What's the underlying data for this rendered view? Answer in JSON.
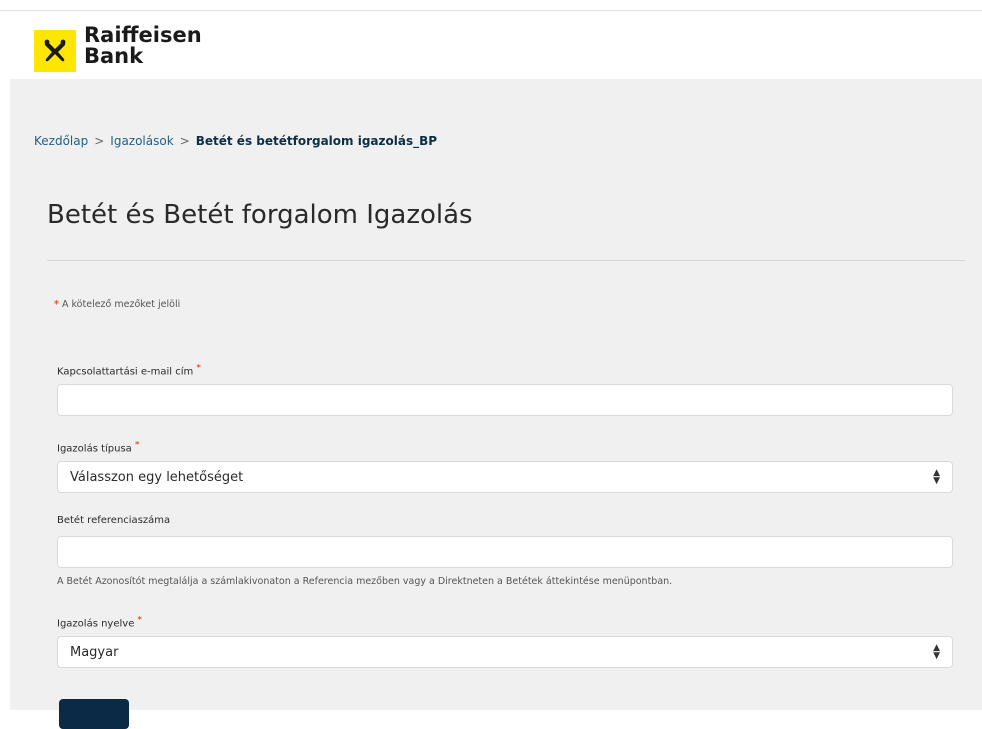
{
  "brand": {
    "logo_line1": "Raiffeisen",
    "logo_line2": "Bank",
    "logo_color": "#fee600"
  },
  "breadcrumb": {
    "items": [
      "Kezdőlap",
      "Igazolások"
    ],
    "current": "Betét és betétforgalom igazolás_BP",
    "separator": ">"
  },
  "page": {
    "title": "Betét és Betét forgalom Igazolás",
    "required_note": "A kötelező mezőket jelöli",
    "required_mark": "*"
  },
  "form": {
    "email": {
      "label": "Kapcsolattartási e-mail cím",
      "value": ""
    },
    "type": {
      "label": "Igazolás típusa",
      "selected": "Válasszon egy lehetőséget"
    },
    "reference": {
      "label": "Betét referenciaszáma",
      "value": "",
      "help": "A Betét Azonosítót megtalálja a számlakivonaton a Referencia mezőben vagy a Direktneten a Betétek áttekintése menüpontban."
    },
    "language": {
      "label": "Igazolás nyelve",
      "selected": "Magyar"
    }
  },
  "colors": {
    "accent_dark": "#0b2a45",
    "required_star": "#e0532f",
    "background_panel": "#f0f0f0"
  }
}
